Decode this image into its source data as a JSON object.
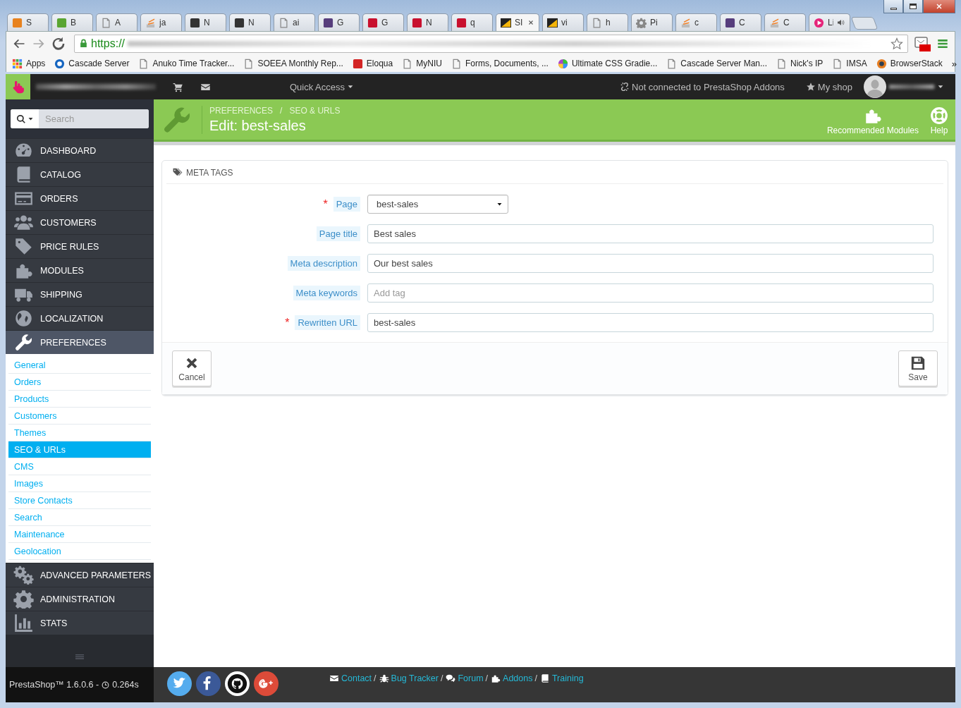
{
  "browser": {
    "tabs": [
      {
        "title": "S",
        "kind": "cp",
        "selected": false,
        "audio": false
      },
      {
        "title": "B",
        "kind": "bug",
        "selected": false,
        "audio": false
      },
      {
        "title": "A",
        "kind": "page",
        "selected": false,
        "audio": false
      },
      {
        "title": "ja",
        "kind": "stack",
        "selected": false,
        "audio": false
      },
      {
        "title": "N",
        "kind": "code",
        "selected": false,
        "audio": false
      },
      {
        "title": "N",
        "kind": "code",
        "selected": false,
        "audio": false
      },
      {
        "title": "ai",
        "kind": "page",
        "selected": false,
        "audio": false
      },
      {
        "title": "G",
        "kind": "bootstrap",
        "selected": false,
        "audio": false
      },
      {
        "title": "G",
        "kind": "niu",
        "selected": false,
        "audio": false
      },
      {
        "title": "N",
        "kind": "niu",
        "selected": false,
        "audio": false
      },
      {
        "title": "q",
        "kind": "niu",
        "selected": false,
        "audio": false
      },
      {
        "title": "SI",
        "kind": "presta",
        "selected": true,
        "audio": false
      },
      {
        "title": "vi",
        "kind": "presta",
        "selected": false,
        "audio": false
      },
      {
        "title": "h",
        "kind": "page",
        "selected": false,
        "audio": false
      },
      {
        "title": "Pi",
        "kind": "gear",
        "selected": false,
        "audio": false
      },
      {
        "title": "c",
        "kind": "stack",
        "selected": false,
        "audio": false
      },
      {
        "title": "C",
        "kind": "bootstrap",
        "selected": false,
        "audio": false
      },
      {
        "title": "C",
        "kind": "stack",
        "selected": false,
        "audio": false
      },
      {
        "title": "Li",
        "kind": "play",
        "selected": false,
        "audio": true
      }
    ],
    "address": {
      "scheme": "https://"
    },
    "bookmarks": [
      {
        "label": "Apps",
        "kind": "apps"
      },
      {
        "label": "Cascade Server",
        "kind": "swirl"
      },
      {
        "label": "Anuko Time Tracker...",
        "kind": "page"
      },
      {
        "label": "SOEEA Monthly Rep...",
        "kind": "page"
      },
      {
        "label": "Eloqua",
        "kind": "red"
      },
      {
        "label": "MyNIU",
        "kind": "page"
      },
      {
        "label": "Forms, Documents, ...",
        "kind": "page"
      },
      {
        "label": "Ultimate CSS Gradie...",
        "kind": "wheel"
      },
      {
        "label": "Cascade Server Man...",
        "kind": "page"
      },
      {
        "label": "Nick's IP",
        "kind": "page"
      },
      {
        "label": "IMSA",
        "kind": "page"
      },
      {
        "label": "BrowserStack",
        "kind": "orb"
      }
    ],
    "bookmarks_more": "»"
  },
  "topbar": {
    "quick_access": "Quick Access",
    "addons_status": "Not connected to PrestaShop Addons",
    "shop_link": "My shop"
  },
  "sidebar": {
    "search": {
      "placeholder": "Search"
    },
    "items": [
      {
        "label": "DASHBOARD",
        "kind": "gauge",
        "selected": false
      },
      {
        "label": "CATALOG",
        "kind": "book",
        "selected": false
      },
      {
        "label": "ORDERS",
        "kind": "card",
        "selected": false
      },
      {
        "label": "CUSTOMERS",
        "kind": "people",
        "selected": false
      },
      {
        "label": "PRICE RULES",
        "kind": "tag",
        "selected": false
      },
      {
        "label": "MODULES",
        "kind": "puzzle",
        "selected": false
      },
      {
        "label": "SHIPPING",
        "kind": "truck",
        "selected": false
      },
      {
        "label": "LOCALIZATION",
        "kind": "globe",
        "selected": false
      },
      {
        "label": "PREFERENCES",
        "kind": "wrench",
        "selected": true,
        "children": [
          {
            "label": "General",
            "selected": false
          },
          {
            "label": "Orders",
            "selected": false
          },
          {
            "label": "Products",
            "selected": false
          },
          {
            "label": "Customers",
            "selected": false
          },
          {
            "label": "Themes",
            "selected": false
          },
          {
            "label": "SEO & URLs",
            "selected": true
          },
          {
            "label": "CMS",
            "selected": false
          },
          {
            "label": "Images",
            "selected": false
          },
          {
            "label": "Store Contacts",
            "selected": false
          },
          {
            "label": "Search",
            "selected": false
          },
          {
            "label": "Maintenance",
            "selected": false
          },
          {
            "label": "Geolocation",
            "selected": false
          }
        ]
      },
      {
        "label": "ADVANCED PARAMETERS",
        "kind": "gears",
        "selected": false
      },
      {
        "label": "ADMINISTRATION",
        "kind": "gear",
        "selected": false
      },
      {
        "label": "STATS",
        "kind": "bars",
        "selected": false
      }
    ],
    "version": "PrestaShop™ 1.6.0.6 -",
    "load_time": "0.264s"
  },
  "header": {
    "breadcrumb": [
      "PREFERENCES",
      "SEO & URLS"
    ],
    "breadcrumb_separator": "/",
    "title": "Edit: best-sales",
    "toolbar": [
      {
        "label": "Recommended Modules",
        "kind": "puzzle"
      },
      {
        "label": "Help",
        "kind": "lifebuoy"
      }
    ]
  },
  "panel": {
    "title": "META TAGS",
    "fields": [
      {
        "label": "Page",
        "required_mark": "*",
        "kind": "select",
        "value": "best-sales"
      },
      {
        "label": "Page title",
        "kind": "text",
        "value": "Best sales"
      },
      {
        "label": "Meta description",
        "kind": "text",
        "value": "Our best sales"
      },
      {
        "label": "Meta keywords",
        "kind": "tags",
        "placeholder": "Add tag"
      },
      {
        "label": "Rewritten URL",
        "required_mark": "*",
        "kind": "text",
        "value": "best-sales"
      }
    ],
    "buttons": [
      {
        "label": "Cancel",
        "kind": "cancel"
      },
      {
        "label": "Save",
        "kind": "save"
      }
    ]
  },
  "footer": {
    "social": [
      {
        "kind": "twitter"
      },
      {
        "kind": "facebook"
      },
      {
        "kind": "github"
      },
      {
        "kind": "gplus"
      }
    ],
    "links": [
      {
        "label": "Contact",
        "kind": "envelope",
        "separator": "/"
      },
      {
        "label": "Bug Tracker",
        "kind": "bug",
        "separator": "/"
      },
      {
        "label": "Forum",
        "kind": "comments",
        "separator": "/"
      },
      {
        "label": "Addons",
        "kind": "puzzle",
        "separator": "/"
      },
      {
        "label": "Training",
        "kind": "book"
      }
    ]
  }
}
